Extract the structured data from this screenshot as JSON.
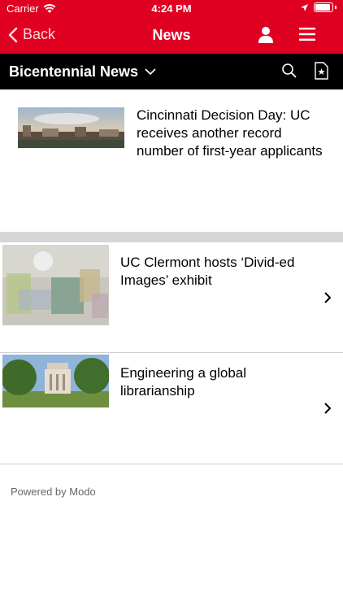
{
  "status_bar": {
    "carrier": "Carrier",
    "time": "4:24 PM"
  },
  "nav": {
    "back_label": "Back",
    "title": "News"
  },
  "subbar": {
    "title": "Bicentennial News"
  },
  "articles": [
    {
      "title": "Cincinnati Decision Day: UC receives another record number of first-year applicants"
    },
    {
      "title": "UC Clermont hosts ‘Divid-ed Images’ exhibit"
    },
    {
      "title": "Engineering a global librarianship"
    }
  ],
  "footer": {
    "text": "Powered by Modo"
  },
  "colors": {
    "brand_red": "#e00122",
    "subbar_black": "#000000",
    "divider_gray": "#d6d6d6"
  }
}
